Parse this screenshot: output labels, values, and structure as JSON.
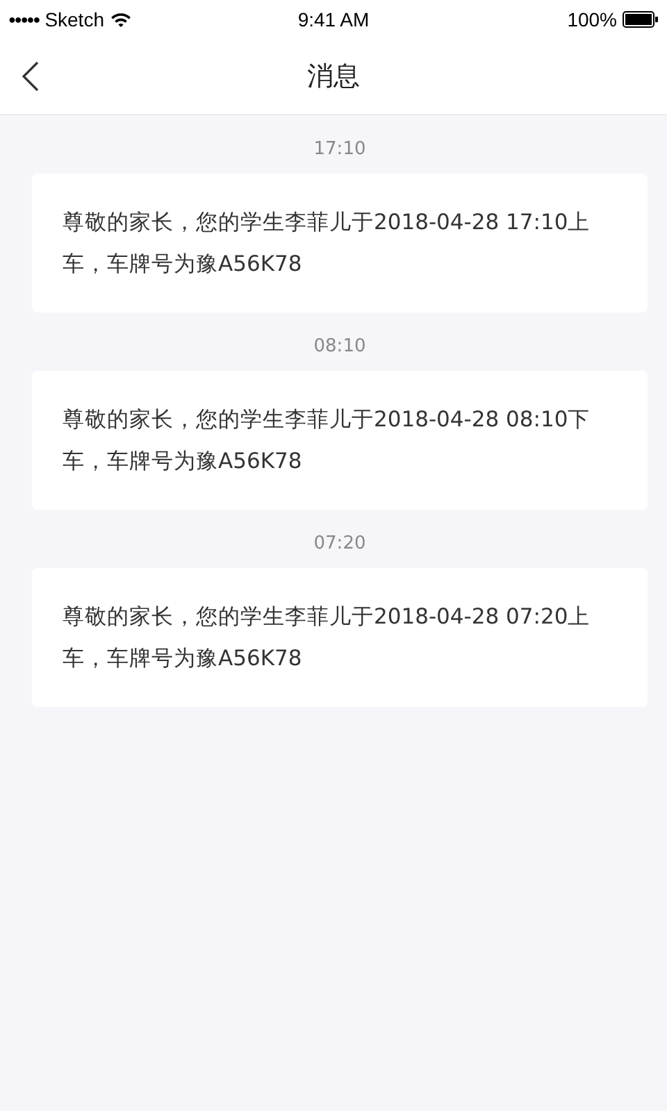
{
  "status_bar": {
    "signal_dots": "●●●●●",
    "carrier": "Sketch",
    "time": "9:41 AM",
    "battery": "100%"
  },
  "nav": {
    "title": "消息"
  },
  "messages": [
    {
      "time": "17:10",
      "text": "尊敬的家长，您的学生李菲儿于2018-04-28 17:10上车，车牌号为豫A56K78"
    },
    {
      "time": "08:10",
      "text": "尊敬的家长，您的学生李菲儿于2018-04-28 08:10下车，车牌号为豫A56K78"
    },
    {
      "time": "07:20",
      "text": "尊敬的家长，您的学生李菲儿于2018-04-28 07:20上车，车牌号为豫A56K78"
    }
  ]
}
